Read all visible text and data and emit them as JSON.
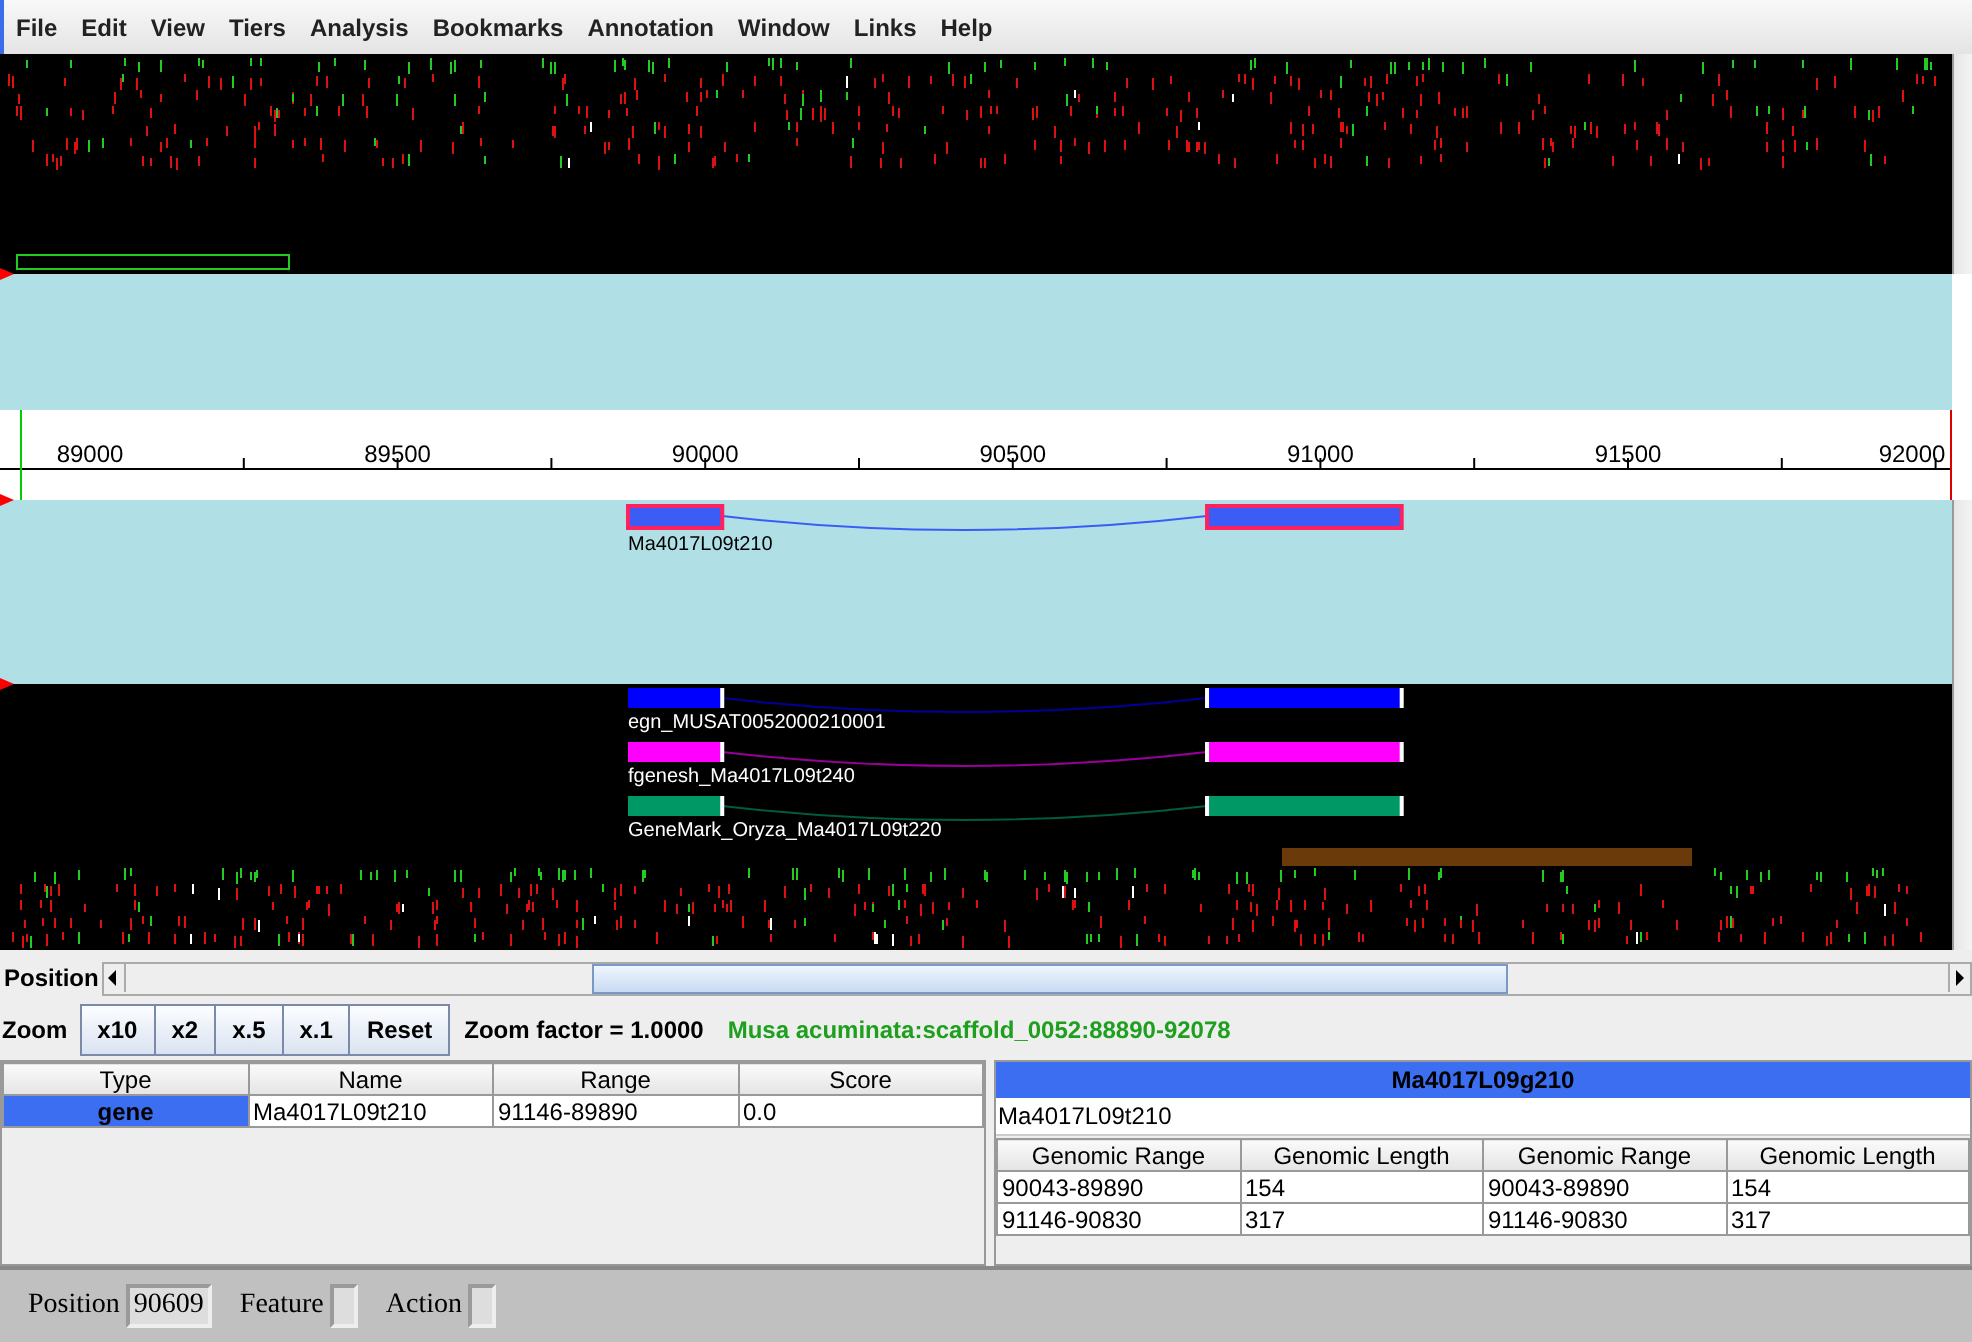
{
  "menu": [
    {
      "label": "File"
    },
    {
      "label": "Edit"
    },
    {
      "label": "View"
    },
    {
      "label": "Tiers"
    },
    {
      "label": "Analysis"
    },
    {
      "label": "Bookmarks"
    },
    {
      "label": "Annotation"
    },
    {
      "label": "Window"
    },
    {
      "label": "Links"
    },
    {
      "label": "Help"
    }
  ],
  "ruler": {
    "labels": [
      "89000",
      "89500",
      "90000",
      "90500",
      "91000",
      "91500",
      "92000"
    ]
  },
  "annotation_tier": {
    "genes": [
      {
        "name": "Ma4017L09t210",
        "color": "#3b5cf5",
        "selected": true
      }
    ]
  },
  "result_tier": {
    "genes": [
      {
        "name": "egn_MUSAT0052000210001",
        "color": "#0000ff",
        "selected": false
      },
      {
        "name": "fgenesh_Ma4017L09t240",
        "color": "#ff00ff",
        "selected": false
      },
      {
        "name": "GeneMark_Oryza_Ma4017L09t220",
        "color": "#009966",
        "selected": false
      }
    ]
  },
  "scrollbar": {
    "label": "Position"
  },
  "zoom": {
    "label": "Zoom",
    "buttons": [
      "x10",
      "x2",
      "x.5",
      "x.1",
      "Reset"
    ],
    "factor": "Zoom factor = 1.0000",
    "location": "Musa acuminata:scaffold_0052:88890-92078"
  },
  "feature_table": {
    "columns": [
      "Type",
      "Name",
      "Range",
      "Score"
    ],
    "rows": [
      {
        "cells": [
          "gene",
          "Ma4017L09t210",
          "91146-89890",
          "0.0"
        ],
        "selected": true
      }
    ]
  },
  "detail": {
    "title": "Ma4017L09g210",
    "name": "Ma4017L09t210",
    "columns": [
      "Genomic Range",
      "Genomic Length",
      "Genomic Range",
      "Genomic Length"
    ],
    "rows": [
      [
        "90043-89890",
        "154",
        "90043-89890",
        "154"
      ],
      [
        "91146-90830",
        "317",
        "91146-90830",
        "317"
      ]
    ]
  },
  "status_bar": [
    {
      "label": "Position",
      "value": "90609"
    },
    {
      "label": "Feature"
    },
    {
      "label": "Action"
    }
  ]
}
